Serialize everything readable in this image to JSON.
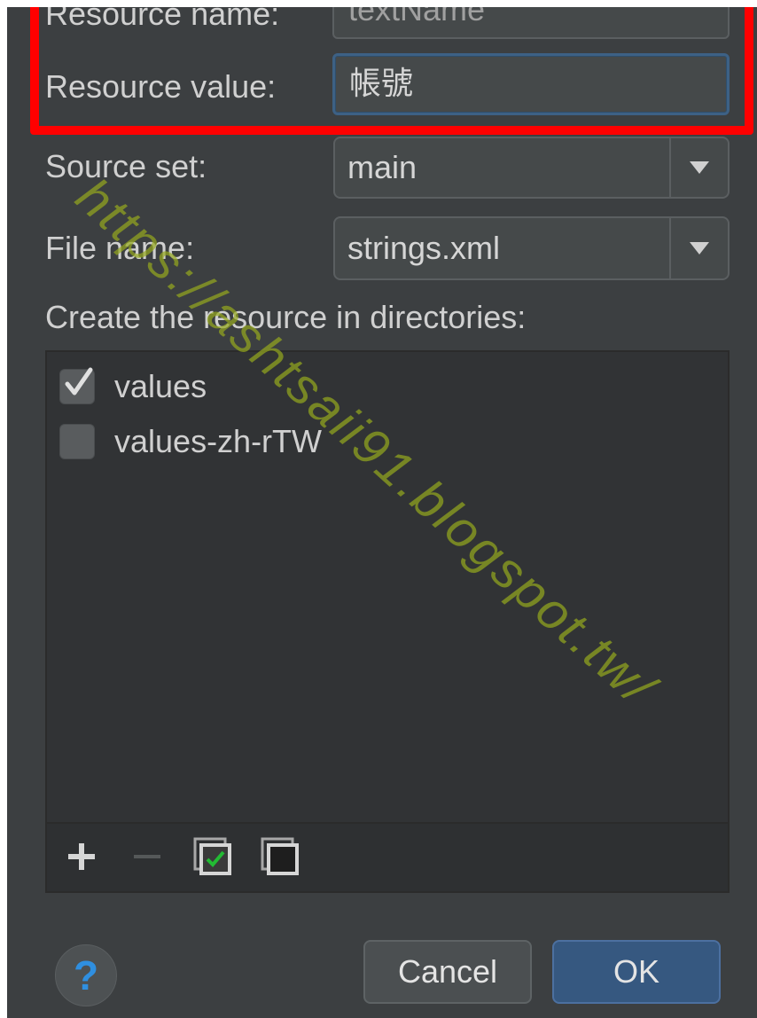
{
  "form": {
    "resource_name_label": "Resource name:",
    "resource_name_value": "textName",
    "resource_value_label": "Resource value:",
    "resource_value_value": "帳號",
    "source_set_label": "Source set:",
    "source_set_value": "main",
    "file_name_label": "File name:",
    "file_name_value": "strings.xml",
    "directories_label": "Create the resource in directories:"
  },
  "directories": [
    {
      "label": "values",
      "checked": true
    },
    {
      "label": "values-zh-rTW",
      "checked": false
    }
  ],
  "toolbar_icons": [
    "plus-icon",
    "minus-icon",
    "select-all-icon",
    "unselect-all-icon"
  ],
  "buttons": {
    "help": "?",
    "cancel": "Cancel",
    "ok": "OK"
  },
  "watermark": "https://ashtsaii91.blogspot.tw/",
  "colors": {
    "background": "#3c3f41",
    "highlight": "#ff0000",
    "ok_button": "#365880",
    "focus_border": "#3d6185",
    "help_icon": "#2f8fe0",
    "check_mark": "#22bb33"
  }
}
